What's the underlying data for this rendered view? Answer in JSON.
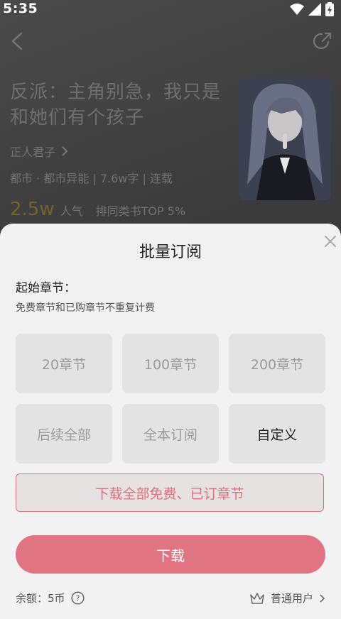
{
  "status_bar": {
    "time": "5:35"
  },
  "book": {
    "title": "反派：主角别急，我只是和她们有个孩子",
    "author": "正人君子",
    "meta": "都市 · 都市异能 | 7.6w字 | 连载",
    "popularity_value": "2.5w",
    "popularity_label": "人气",
    "rank": "排同类书TOP 5%"
  },
  "sheet": {
    "title": "批量订阅",
    "start_label": "起始章节：",
    "note": "免费章节和已购章节不重复计费",
    "options": [
      {
        "label": "20章节"
      },
      {
        "label": "100章节"
      },
      {
        "label": "200章节"
      },
      {
        "label": "后续全部"
      },
      {
        "label": "全本订阅"
      },
      {
        "label": "自定义"
      }
    ],
    "download_all_label": "下载全部免费、已订章节",
    "download_label": "下载",
    "balance": "余额：5币",
    "user_level": "普通用户"
  },
  "colors": {
    "accent": "#e07480",
    "accent_border": "#d9707b",
    "sheet_bg": "#f2f2f2",
    "option_bg": "#e3e3e3"
  },
  "icons": [
    "wifi-icon",
    "signal-icon",
    "battery-icon",
    "back-icon",
    "share-icon",
    "chevron-right-icon",
    "close-icon",
    "help-icon",
    "crown-icon"
  ]
}
